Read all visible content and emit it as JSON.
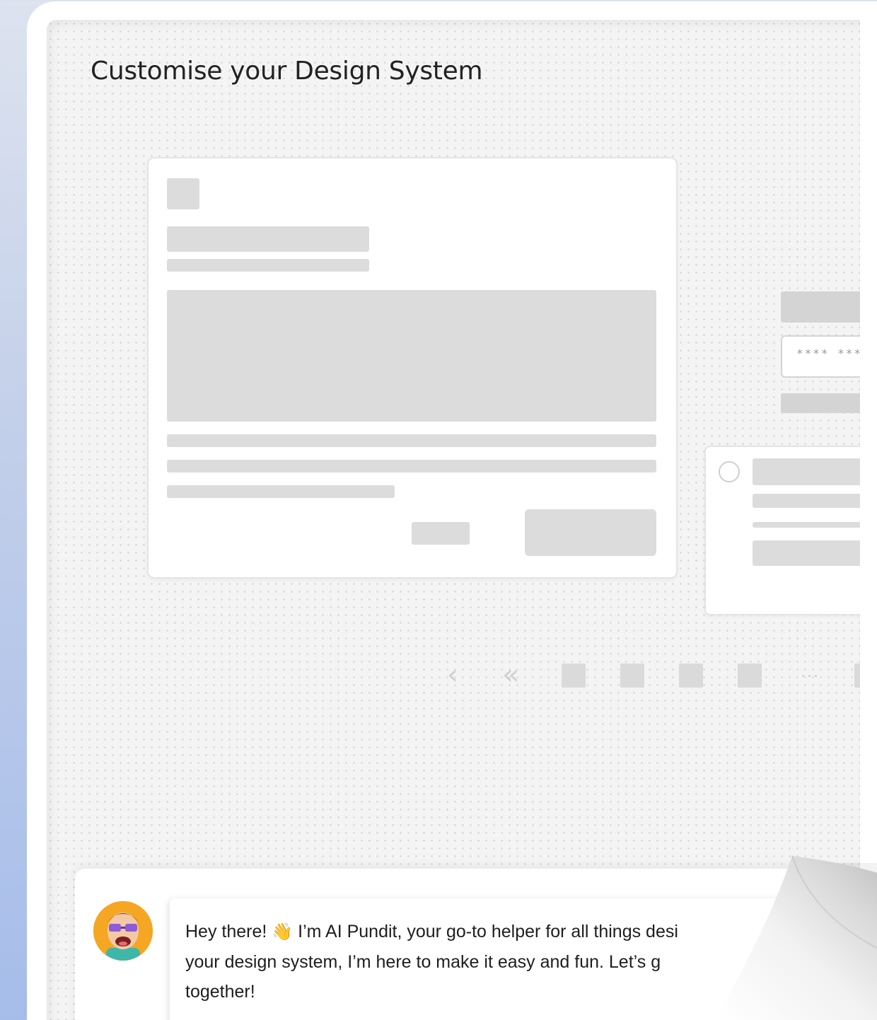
{
  "page": {
    "title": "Customise your Design System"
  },
  "form_preview": {
    "input_placeholder": "**** ***"
  },
  "pagination": {
    "prev_icon": "chevron-left-icon",
    "first_icon": "double-chevron-left-icon",
    "ellipsis": "..."
  },
  "chat": {
    "avatar_icon": "ai-pundit-avatar",
    "message_part1": "Hey there!",
    "wave_emoji": "👋",
    "message_part2": " I’m AI Pundit, your go-to helper for all things desi",
    "message_line2": "your design system, I’m here to make it easy and fun. Let’s g",
    "message_line3": "together!"
  },
  "colors": {
    "background": "#a6bdea",
    "canvas": "#f4f4f4",
    "placeholder_block": "#dcdcdc",
    "avatar_bg": "#f5a623"
  }
}
